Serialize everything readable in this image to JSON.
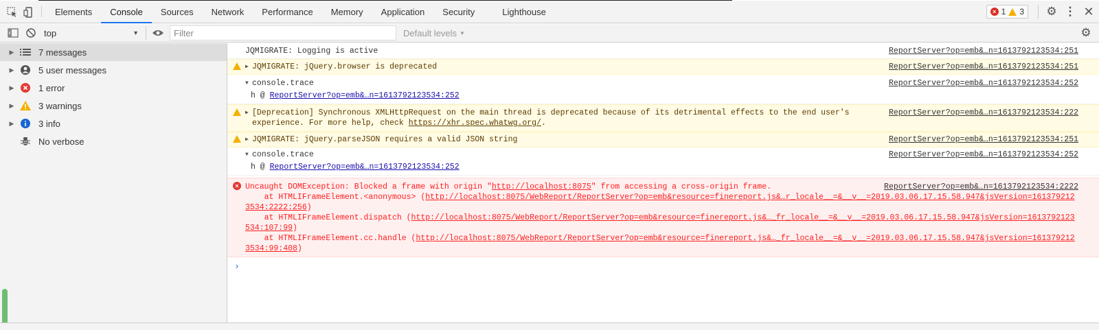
{
  "tabs": [
    {
      "label": "Elements"
    },
    {
      "label": "Console"
    },
    {
      "label": "Network"
    },
    {
      "label": "Sources"
    },
    {
      "label": "Performance"
    },
    {
      "label": "Memory"
    },
    {
      "label": "Application"
    },
    {
      "label": "Security"
    },
    {
      "label": "Lighthouse"
    }
  ],
  "tabs_order": [
    "Elements",
    "Console",
    "Sources",
    "Network",
    "Performance",
    "Memory",
    "Application",
    "Security",
    "Lighthouse"
  ],
  "counts": {
    "errors": "1",
    "warnings": "3"
  },
  "toolbar": {
    "context": "top",
    "filter_placeholder": "Filter",
    "levels": "Default levels"
  },
  "sidebar": {
    "items": [
      {
        "label": "7 messages",
        "icon": "list-icon"
      },
      {
        "label": "5 user messages",
        "icon": "user-icon"
      },
      {
        "label": "1 error",
        "icon": "error-icon"
      },
      {
        "label": "3 warnings",
        "icon": "warning-icon"
      },
      {
        "label": "3 info",
        "icon": "info-icon"
      },
      {
        "label": "No verbose",
        "icon": "bug-icon"
      }
    ]
  },
  "console": {
    "m1": {
      "text": "JQMIGRATE: Logging is active",
      "src": "ReportServer?op=emb&…n=1613792123534:251"
    },
    "m2": {
      "text": "JQMIGRATE: jQuery.browser is deprecated",
      "src": "ReportServer?op=emb&…n=1613792123534:251"
    },
    "m3": {
      "text": "console.trace",
      "src": "ReportServer?op=emb&…n=1613792123534:252",
      "trace_prefix": "h @ ",
      "trace_link": "ReportServer?op=emb&…n=1613792123534:252"
    },
    "m4": {
      "text": "[Deprecation] Synchronous XMLHttpRequest on the main thread is deprecated because of its detrimental effects to the end user's experience. For more help, check ",
      "link": "https://xhr.spec.whatwg.org/",
      "tail": ".",
      "src": "ReportServer?op=emb&…n=1613792123534:222"
    },
    "m5": {
      "text": "JQMIGRATE: jQuery.parseJSON requires a valid JSON string",
      "src": "ReportServer?op=emb&…n=1613792123534:251"
    },
    "m6": {
      "text": "console.trace",
      "src": "ReportServer?op=emb&…n=1613792123534:252",
      "trace_prefix": "h @ ",
      "trace_link": "ReportServer?op=emb&…n=1613792123534:252"
    },
    "m7": {
      "head": "Uncaught DOMException: Blocked a frame with origin \"",
      "origin": "http://localhost:8075",
      "head_tail": "\" from accessing a cross-origin frame.",
      "src": "ReportServer?op=emb&…n=1613792123534:2222",
      "l1_pre": "    at HTMLIFrameElement.<anonymous> (",
      "l1_link": "http://localhost:8075/WebReport/ReportServer?op=emb&resource=finereport.js&…r_locale__=&__v__=2019.03.06.17.15.58.947&jsVersion=1613792123534:2222:256",
      "l2_pre": "    at HTMLIFrameElement.dispatch (",
      "l2_link": "http://localhost:8075/WebReport/ReportServer?op=emb&resource=finereport.js&…_fr_locale__=&__v__=2019.03.06.17.15.58.947&jsVersion=1613792123534:107:99",
      "l3_pre": "    at HTMLIFrameElement.cc.handle (",
      "l3_link": "http://localhost:8075/WebReport/ReportServer?op=emb&resource=finereport.js&…_fr_locale__=&__v__=2019.03.06.17.15.58.947&jsVersion=1613792123534:99:408",
      "close": ")"
    },
    "prompt": "›"
  },
  "colors": {
    "accent": "#1a73e8",
    "error": "#d93025",
    "warning": "#f2b000",
    "info": "#1967d2"
  }
}
